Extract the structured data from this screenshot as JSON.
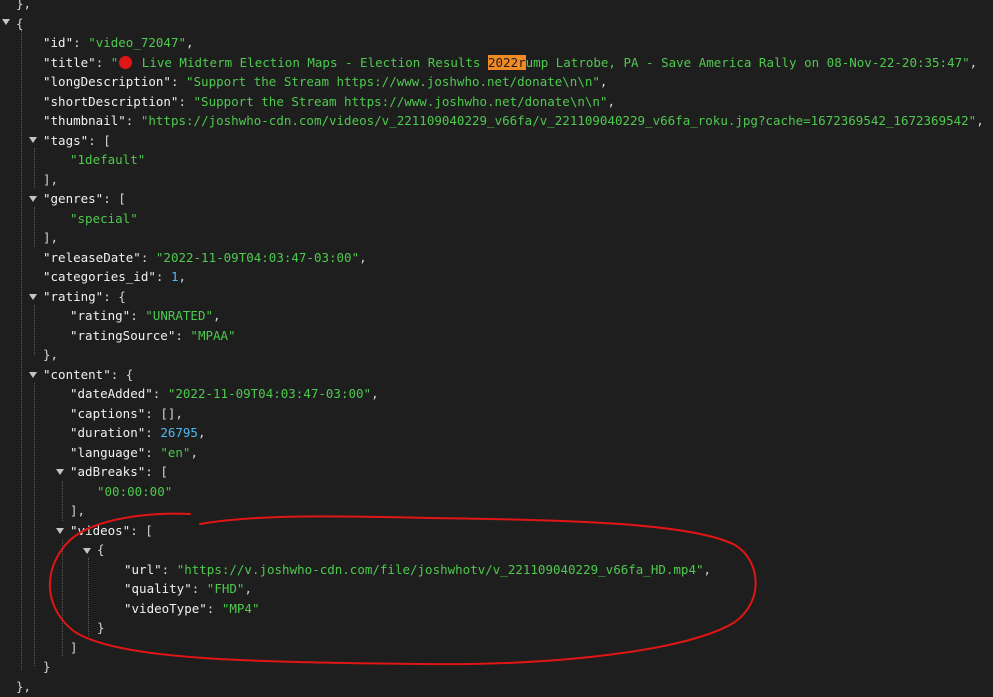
{
  "json_view": {
    "top_close": "},",
    "open_brace": "{",
    "id": {
      "key": "\"id\"",
      "value": "\"video_72047\""
    },
    "title": {
      "key": "\"title\"",
      "value_open_quote": "\"",
      "value_part1": " Live Midterm Election Maps - Election Results ",
      "value_highlight": "2022r",
      "value_part2": "ump Latrobe, PA - Save America Rally on 08-Nov-22-20:35:47\"",
      "icon": "red-circle-icon"
    },
    "longDescription": {
      "key": "\"longDescription\"",
      "value": "\"Support the Stream https://www.joshwho.net/donate\\n\\n\""
    },
    "shortDescription": {
      "key": "\"shortDescription\"",
      "value": "\"Support the Stream https://www.joshwho.net/donate\\n\\n\""
    },
    "thumbnail": {
      "key": "\"thumbnail\"",
      "value": "\"https://joshwho-cdn.com/videos/v_221109040229_v66fa/v_221109040229_v66fa_roku.jpg?cache=1672369542_1672369542\""
    },
    "tags": {
      "key": "\"tags\"",
      "item": "\"1default\""
    },
    "genres": {
      "key": "\"genres\"",
      "item": "\"special\""
    },
    "releaseDate": {
      "key": "\"releaseDate\"",
      "value": "\"2022-11-09T04:03:47-03:00\""
    },
    "categories_id": {
      "key": "\"categories_id\"",
      "value": "1"
    },
    "rating": {
      "key": "\"rating\"",
      "rating_key": "\"rating\"",
      "rating_value": "\"UNRATED\"",
      "source_key": "\"ratingSource\"",
      "source_value": "\"MPAA\""
    },
    "content": {
      "key": "\"content\"",
      "dateAdded_key": "\"dateAdded\"",
      "dateAdded_value": "\"2022-11-09T04:03:47-03:00\"",
      "captions_key": "\"captions\"",
      "captions_value": "[]",
      "duration_key": "\"duration\"",
      "duration_value": "26795",
      "language_key": "\"language\"",
      "language_value": "\"en\"",
      "adBreaks_key": "\"adBreaks\"",
      "adBreaks_item": "\"00:00:00\"",
      "videos_key": "\"videos\"",
      "url_key": "\"url\"",
      "url_value": "\"https://v.joshwho-cdn.com/file/joshwhotv/v_221109040229_v66fa_HD.mp4\"",
      "quality_key": "\"quality\"",
      "quality_value": "\"FHD\"",
      "videoType_key": "\"videoType\"",
      "videoType_value": "\"MP4\""
    },
    "punct": {
      "colon": ": ",
      "comma": ",",
      "open_bracket": "[",
      "close_bracket": "]",
      "close_bracket_comma": "],",
      "open_brace": "{",
      "close_brace": "}",
      "close_brace_comma": "},"
    }
  },
  "colors": {
    "background": "#1e1e1e",
    "key": "#f0f0f0",
    "string": "#4ec94e",
    "number": "#4fb8f0",
    "highlight": "#f08a24",
    "annotation": "#e01515"
  }
}
